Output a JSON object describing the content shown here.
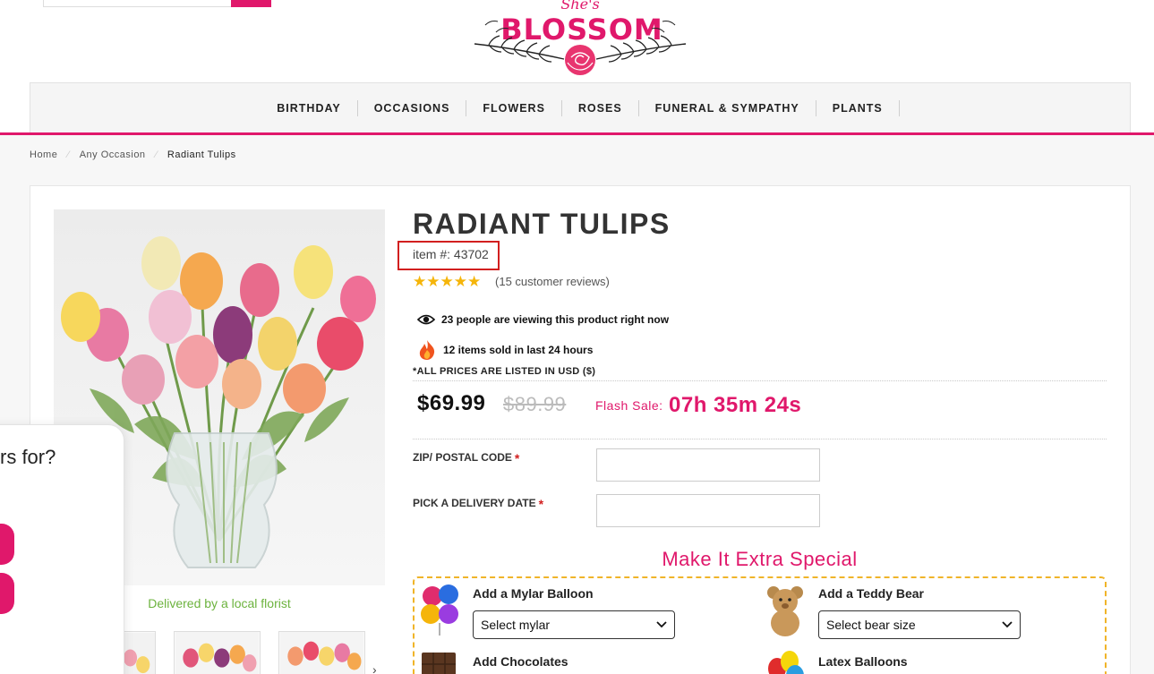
{
  "header": {
    "logo_text": "BLOSSOM",
    "logo_script": "She's"
  },
  "nav": {
    "items": [
      "BIRTHDAY",
      "OCCASIONS",
      "FLOWERS",
      "ROSES",
      "FUNERAL & SYMPATHY",
      "PLANTS"
    ]
  },
  "breadcrumb": {
    "items": [
      "Home",
      "Any Occasion",
      "Radiant Tulips"
    ]
  },
  "product": {
    "title": "RADIANT TULIPS",
    "item_number": "item #: 43702",
    "rating_stars": 5,
    "reviews_prefix": "(",
    "reviews_count": "15",
    "reviews_suffix": " customer reviews)",
    "viewing_text": "23 people are viewing this product right now",
    "sold_text": "12 items sold in last 24 hours",
    "prices_note": "*ALL PRICES ARE LISTED IN USD ($)",
    "price": "$69.99",
    "old_price": "$89.99",
    "flash_label": "Flash Sale:",
    "flash_time": "07h 35m 24s",
    "delivered_text": "Delivered by a local florist"
  },
  "form": {
    "zip_label": "ZIP/ POSTAL CODE",
    "zip_value": "",
    "date_label": "PICK A DELIVERY DATE",
    "date_value": "",
    "required_mark": "*"
  },
  "extras": {
    "title": "Make It Extra Special",
    "mylar_title": "Add a Mylar Balloon",
    "mylar_select": "Select mylar",
    "bear_title": "Add a Teddy Bear",
    "bear_select": "Select bear size",
    "chocolates_title": "Add Chocolates",
    "latex_title": "Latex Balloons"
  },
  "popup": {
    "text": "rs for?"
  },
  "colors": {
    "brand_pink": "#e0186b",
    "delivered_green": "#6cb33e",
    "star_gold": "#f5b50a",
    "highlight_red": "#d21f1f",
    "extra_border": "#f0b429"
  },
  "icons": [
    "search-icon",
    "eye-icon",
    "fire-icon",
    "chevron-down-icon",
    "balloon-icon",
    "teddy-bear-icon",
    "chocolate-icon",
    "latex-balloon-icon"
  ]
}
